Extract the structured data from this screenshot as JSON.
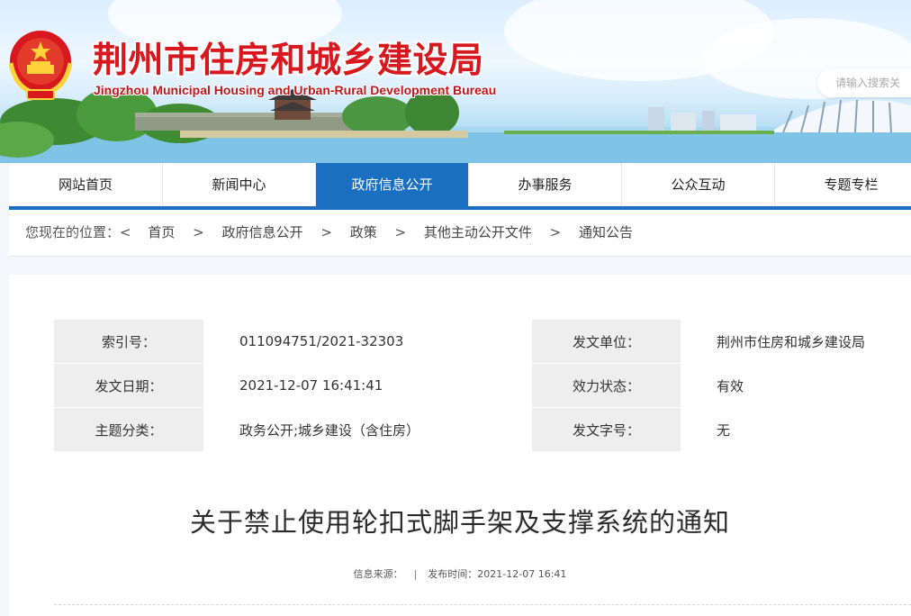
{
  "header": {
    "title_cn": "荆州市住房和城乡建设局",
    "title_en": "Jingzhou Municipal Housing and Urban-Rural Development Bureau",
    "search_placeholder": "请输入搜索关",
    "emblem_icon": "national-emblem-icon",
    "colors": {
      "title": "#d7181e",
      "nav_active": "#1a6fc0"
    }
  },
  "nav": {
    "items": [
      {
        "label": "网站首页"
      },
      {
        "label": "新闻中心"
      },
      {
        "label": "政府信息公开",
        "active": true
      },
      {
        "label": "办事服务"
      },
      {
        "label": "公众互动"
      },
      {
        "label": "专题专栏"
      }
    ]
  },
  "breadcrumb": {
    "lead": "您现在的位置：",
    "back_glyph": "<",
    "separator": ">",
    "items": [
      "首页",
      "政府信息公开",
      "政策",
      "其他主动公开文件",
      "通知公告"
    ]
  },
  "meta": {
    "rows": [
      {
        "k1": "索引号：",
        "v1": "011094751/2021-32303",
        "k2": "发文单位：",
        "v2": "荆州市住房和城乡建设局"
      },
      {
        "k1": "发文日期：",
        "v1": "2021-12-07 16:41:41",
        "k2": "效力状态：",
        "v2": "有效"
      },
      {
        "k1": "主题分类：",
        "v1": "政务公开;城乡建设（含住房）",
        "k2": "发文字号：",
        "v2": "无"
      }
    ]
  },
  "article": {
    "title": "关于禁止使用轮扣式脚手架及支撑系统的通知",
    "source_label": "信息来源：",
    "divider": "|",
    "published": "发布时间：2021-12-07 16:41"
  }
}
